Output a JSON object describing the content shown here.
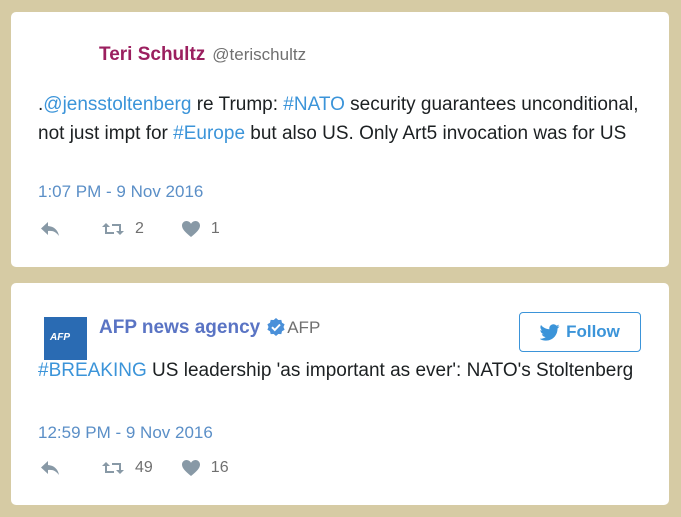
{
  "tweet1": {
    "display_name": "Teri Schultz",
    "handle": "@terischultz",
    "name_color": "#9b1f5f",
    "text": {
      "p1": ".",
      "mention": "@jensstoltenberg",
      "p2": " re Trump: ",
      "tag1": "#NATO",
      "p3": " security guarantees unconditional, not just impt for ",
      "tag2": "#Europe",
      "p4": " but also US. Only Art5 invocation was for US"
    },
    "time": "1:07 PM - 9 Nov 2016",
    "retweets": "2",
    "likes": "1"
  },
  "tweet2": {
    "display_name": "AFP news agency",
    "handle": "AFP",
    "name_color": "#5a74c4",
    "avatar_text": "AFP",
    "follow_label": "Follow",
    "text": {
      "tag": "#BREAKING",
      "p1": " US leadership 'as important as ever': NATO's Stoltenberg"
    },
    "time": "12:59 PM - 9 Nov 2016",
    "retweets": "49",
    "likes": "16"
  },
  "icons": [
    "reply-icon",
    "retweet-icon",
    "heart-icon",
    "verified-badge-icon",
    "twitter-bird-icon"
  ]
}
